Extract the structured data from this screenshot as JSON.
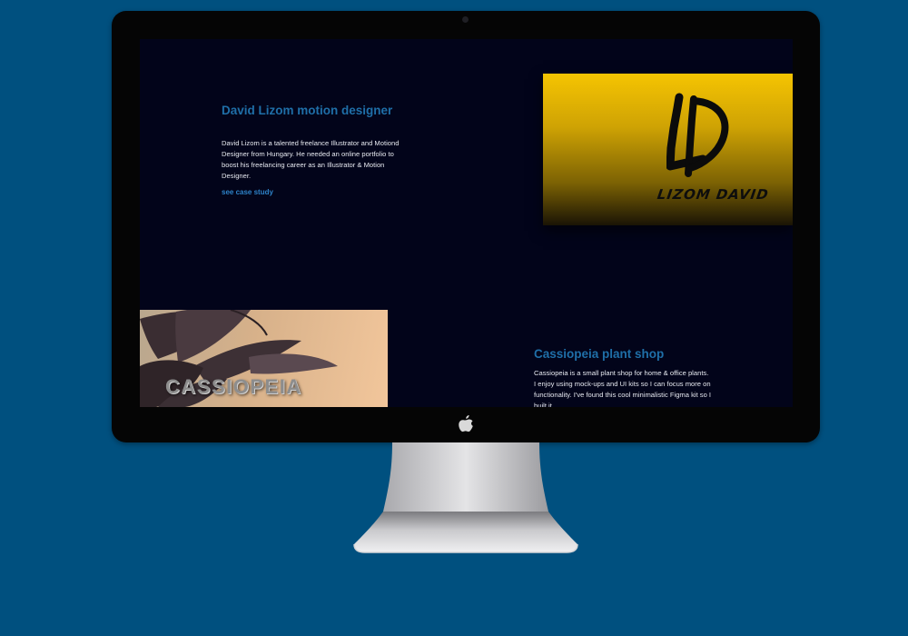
{
  "projects": [
    {
      "title": "David Lizom motion designer",
      "description": "David Lizom is a talented freelance Illustrator and Motiond Designer from Hungary. He needed an online portfolio to boost his freelancing career as an Illustrator & Motion Designer.",
      "link": "see case study",
      "image_wordmark": "LIZOM DAVID"
    },
    {
      "title": "Cassiopeia plant shop",
      "description": "Cassiopeia is a small plant shop for home & office plants. I enjoy using mock-ups and UI kits so I can focus more on functionality. I've found this cool minimalistic Figma kit so I built it",
      "image_wordmark": "CASSIOPEIA"
    }
  ],
  "colors": {
    "background": "#00507f",
    "screen": "#02041a",
    "title_accent": "#1f6fa8",
    "link_accent": "#2d82c8",
    "lizom_yellow": "#f5c402"
  },
  "icons": {
    "hardware_logo": "apple-icon"
  }
}
